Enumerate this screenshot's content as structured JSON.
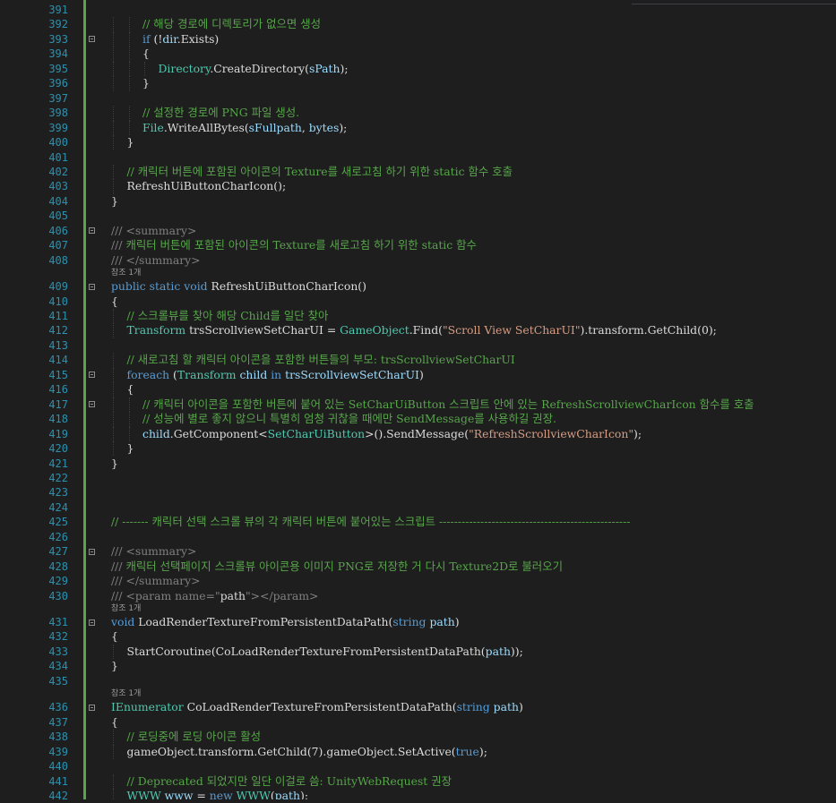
{
  "theme": {
    "background": "#1e1e1e",
    "line_number": "#2b91af",
    "keyword": "#569cd6",
    "type": "#4ec9b0",
    "comment": "#57a64a",
    "string": "#d69d85",
    "xml_doc": "#808080",
    "identifier": "#9cdcfe",
    "text": "#dcdcdc",
    "change_bar": "#57a64a"
  },
  "lines": [
    {
      "n": "391",
      "indent": 0,
      "tokens": []
    },
    {
      "n": "392",
      "indent": 3,
      "tokens": [
        {
          "t": "cm",
          "v": "// 해당 경로에 디렉토리가 없으면 생성"
        }
      ]
    },
    {
      "n": "393",
      "indent": 3,
      "tokens": [
        {
          "t": "kw",
          "v": "if"
        },
        {
          "t": "pl",
          "v": " (!"
        },
        {
          "t": "id",
          "v": "dir"
        },
        {
          "t": "pl",
          "v": ".Exists)"
        }
      ]
    },
    {
      "n": "394",
      "indent": 3,
      "tokens": [
        {
          "t": "pl",
          "v": "{"
        }
      ]
    },
    {
      "n": "395",
      "indent": 4,
      "tokens": [
        {
          "t": "ty",
          "v": "Directory"
        },
        {
          "t": "pl",
          "v": ".CreateDirectory("
        },
        {
          "t": "id",
          "v": "sPath"
        },
        {
          "t": "pl",
          "v": ");"
        }
      ]
    },
    {
      "n": "396",
      "indent": 3,
      "tokens": [
        {
          "t": "pl",
          "v": "}"
        }
      ]
    },
    {
      "n": "397",
      "indent": 0,
      "tokens": []
    },
    {
      "n": "398",
      "indent": 3,
      "tokens": [
        {
          "t": "cm",
          "v": "// 설정한 경로에 PNG 파일 생성."
        }
      ]
    },
    {
      "n": "399",
      "indent": 3,
      "tokens": [
        {
          "t": "ty",
          "v": "File"
        },
        {
          "t": "pl",
          "v": ".WriteAllBytes("
        },
        {
          "t": "id",
          "v": "sFullpath"
        },
        {
          "t": "pl",
          "v": ", "
        },
        {
          "t": "id",
          "v": "bytes"
        },
        {
          "t": "pl",
          "v": ");"
        }
      ]
    },
    {
      "n": "400",
      "indent": 2,
      "tokens": [
        {
          "t": "pl",
          "v": "}"
        }
      ]
    },
    {
      "n": "401",
      "indent": 0,
      "tokens": []
    },
    {
      "n": "402",
      "indent": 2,
      "tokens": [
        {
          "t": "cm",
          "v": "// 캐릭터 버튼에 포함된 아이콘의 Texture를 새로고침 하기 위한 static 함수 호출"
        }
      ]
    },
    {
      "n": "403",
      "indent": 2,
      "tokens": [
        {
          "t": "pl",
          "v": "RefreshUiButtonCharIcon();"
        }
      ]
    },
    {
      "n": "404",
      "indent": 1,
      "tokens": [
        {
          "t": "pl",
          "v": "}"
        }
      ]
    },
    {
      "n": "405",
      "indent": 0,
      "tokens": []
    },
    {
      "n": "406",
      "indent": 1,
      "tokens": [
        {
          "t": "xd",
          "v": "/// <summary>"
        }
      ]
    },
    {
      "n": "407",
      "indent": 1,
      "tokens": [
        {
          "t": "xd",
          "v": "/// "
        },
        {
          "t": "cm",
          "v": "캐릭터 버튼에 포함된 아이콘의 Texture를 새로고침 하기 위한 static 함수"
        }
      ]
    },
    {
      "n": "408",
      "indent": 1,
      "tokens": [
        {
          "t": "xd",
          "v": "/// </summary>"
        }
      ]
    },
    {
      "n": "409",
      "indent": 1,
      "lens": "참조 1개",
      "tokens": [
        {
          "t": "kw",
          "v": "public"
        },
        {
          "t": "pl",
          "v": " "
        },
        {
          "t": "kw",
          "v": "static"
        },
        {
          "t": "pl",
          "v": " "
        },
        {
          "t": "kw",
          "v": "void"
        },
        {
          "t": "pl",
          "v": " RefreshUiButtonCharIcon()"
        }
      ]
    },
    {
      "n": "410",
      "indent": 1,
      "tokens": [
        {
          "t": "pl",
          "v": "{"
        }
      ]
    },
    {
      "n": "411",
      "indent": 2,
      "tokens": [
        {
          "t": "cm",
          "v": "// 스크롤뷰를 찾아 해당 Child를 일단 찾아"
        }
      ]
    },
    {
      "n": "412",
      "indent": 2,
      "tokens": [
        {
          "t": "ty",
          "v": "Transform"
        },
        {
          "t": "pl",
          "v": " trsScrollviewSetCharUI = "
        },
        {
          "t": "ty",
          "v": "GameObject"
        },
        {
          "t": "pl",
          "v": ".Find("
        },
        {
          "t": "st",
          "v": "\"Scroll View SetCharUI\""
        },
        {
          "t": "pl",
          "v": ").transform.GetChild(0);"
        }
      ]
    },
    {
      "n": "413",
      "indent": 0,
      "tokens": []
    },
    {
      "n": "414",
      "indent": 2,
      "tokens": [
        {
          "t": "cm",
          "v": "// 새로고침 할 캐릭터 아이콘을 포함한 버튼들의 부모: trsScrollviewSetCharUI"
        }
      ]
    },
    {
      "n": "415",
      "indent": 2,
      "tokens": [
        {
          "t": "kw",
          "v": "foreach"
        },
        {
          "t": "pl",
          "v": " ("
        },
        {
          "t": "ty",
          "v": "Transform"
        },
        {
          "t": "pl",
          "v": " "
        },
        {
          "t": "id",
          "v": "child"
        },
        {
          "t": "pl",
          "v": " "
        },
        {
          "t": "kw",
          "v": "in"
        },
        {
          "t": "pl",
          "v": " "
        },
        {
          "t": "id",
          "v": "trsScrollviewSetCharUI"
        },
        {
          "t": "pl",
          "v": ")"
        }
      ]
    },
    {
      "n": "416",
      "indent": 2,
      "tokens": [
        {
          "t": "pl",
          "v": "{"
        }
      ]
    },
    {
      "n": "417",
      "indent": 3,
      "tokens": [
        {
          "t": "cm",
          "v": "// 캐릭터 아이콘을 포함한 버튼에 붙어 있는 SetCharUiButton 스크립트 안에 있는 RefreshScrollviewCharIcon 함수를 호출"
        }
      ]
    },
    {
      "n": "418",
      "indent": 3,
      "tokens": [
        {
          "t": "cm",
          "v": "// 성능에 별로 좋지 않으니 특별히 엄청 귀찮을 때에만 SendMessage를 사용하길 권장."
        }
      ]
    },
    {
      "n": "419",
      "indent": 3,
      "tokens": [
        {
          "t": "id",
          "v": "child"
        },
        {
          "t": "pl",
          "v": ".GetComponent<"
        },
        {
          "t": "ty",
          "v": "SetCharUiButton"
        },
        {
          "t": "pl",
          "v": ">().SendMessage("
        },
        {
          "t": "st",
          "v": "\"RefreshScrollviewCharIcon\""
        },
        {
          "t": "pl",
          "v": ");"
        }
      ]
    },
    {
      "n": "420",
      "indent": 2,
      "tokens": [
        {
          "t": "pl",
          "v": "}"
        }
      ]
    },
    {
      "n": "421",
      "indent": 1,
      "tokens": [
        {
          "t": "pl",
          "v": "}"
        }
      ]
    },
    {
      "n": "422",
      "indent": 0,
      "tokens": []
    },
    {
      "n": "423",
      "indent": 0,
      "tokens": []
    },
    {
      "n": "424",
      "indent": 0,
      "tokens": []
    },
    {
      "n": "425",
      "indent": 1,
      "tokens": [
        {
          "t": "cm",
          "v": "// ------- 캐릭터 선택 스크롤 뷰의 각 캐릭터 버튼에 붙어있는 스크립트 ---------------------------------------------------"
        }
      ]
    },
    {
      "n": "426",
      "indent": 0,
      "tokens": []
    },
    {
      "n": "427",
      "indent": 1,
      "tokens": [
        {
          "t": "xd",
          "v": "/// <summary>"
        }
      ]
    },
    {
      "n": "428",
      "indent": 1,
      "tokens": [
        {
          "t": "xd",
          "v": "/// "
        },
        {
          "t": "cm",
          "v": "캐릭터 선택페이지 스크롤뷰 아이콘용 이미지 PNG로 저장한 거 다시 Texture2D로 불러오기"
        }
      ]
    },
    {
      "n": "429",
      "indent": 1,
      "tokens": [
        {
          "t": "xd",
          "v": "/// </summary>"
        }
      ]
    },
    {
      "n": "430",
      "indent": 1,
      "tokens": [
        {
          "t": "xd",
          "v": "/// <param name=\""
        },
        {
          "t": "pl",
          "v": "path"
        },
        {
          "t": "xd",
          "v": "\"></param>"
        }
      ]
    },
    {
      "n": "431",
      "indent": 1,
      "lens": "참조 1개",
      "tokens": [
        {
          "t": "kw",
          "v": "void"
        },
        {
          "t": "pl",
          "v": " LoadRenderTextureFromPersistentDataPath("
        },
        {
          "t": "kw",
          "v": "string"
        },
        {
          "t": "pl",
          "v": " "
        },
        {
          "t": "id",
          "v": "path"
        },
        {
          "t": "pl",
          "v": ")"
        }
      ]
    },
    {
      "n": "432",
      "indent": 1,
      "tokens": [
        {
          "t": "pl",
          "v": "{"
        }
      ]
    },
    {
      "n": "433",
      "indent": 2,
      "tokens": [
        {
          "t": "pl",
          "v": "StartCoroutine(CoLoadRenderTextureFromPersistentDataPath("
        },
        {
          "t": "id",
          "v": "path"
        },
        {
          "t": "pl",
          "v": "));"
        }
      ]
    },
    {
      "n": "434",
      "indent": 1,
      "tokens": [
        {
          "t": "pl",
          "v": "}"
        }
      ]
    },
    {
      "n": "435",
      "indent": 0,
      "tokens": []
    },
    {
      "n": "436",
      "indent": 1,
      "lens": "참조 1개",
      "tokens": [
        {
          "t": "ty",
          "v": "IEnumerator"
        },
        {
          "t": "pl",
          "v": " CoLoadRenderTextureFromPersistentDataPath("
        },
        {
          "t": "kw",
          "v": "string"
        },
        {
          "t": "pl",
          "v": " "
        },
        {
          "t": "id",
          "v": "path"
        },
        {
          "t": "pl",
          "v": ")"
        }
      ]
    },
    {
      "n": "437",
      "indent": 1,
      "tokens": [
        {
          "t": "pl",
          "v": "{"
        }
      ]
    },
    {
      "n": "438",
      "indent": 2,
      "tokens": [
        {
          "t": "cm",
          "v": "// 로딩중에 로딩 아이콘 활성"
        }
      ]
    },
    {
      "n": "439",
      "indent": 2,
      "tokens": [
        {
          "t": "pl",
          "v": "gameObject.transform.GetChild(7).gameObject.SetActive("
        },
        {
          "t": "kw",
          "v": "true"
        },
        {
          "t": "pl",
          "v": ");"
        }
      ]
    },
    {
      "n": "440",
      "indent": 0,
      "tokens": []
    },
    {
      "n": "441",
      "indent": 2,
      "tokens": [
        {
          "t": "cm",
          "v": "// Deprecated 되었지만 일단 이걸로 씀: UnityWebRequest 권장"
        }
      ]
    },
    {
      "n": "442",
      "indent": 2,
      "tokens": [
        {
          "t": "ty",
          "v": "WWW"
        },
        {
          "t": "pl",
          "v": " "
        },
        {
          "t": "id",
          "v": "www"
        },
        {
          "t": "pl",
          "v": " = "
        },
        {
          "t": "kw",
          "v": "new"
        },
        {
          "t": "pl",
          "v": " "
        },
        {
          "t": "ty",
          "v": "WWW"
        },
        {
          "t": "pl",
          "v": "("
        },
        {
          "t": "id",
          "v": "path"
        },
        {
          "t": "pl",
          "v": ");"
        }
      ]
    }
  ],
  "fold_markers": [
    "393",
    "406",
    "409",
    "415",
    "417",
    "427",
    "431",
    "436"
  ]
}
